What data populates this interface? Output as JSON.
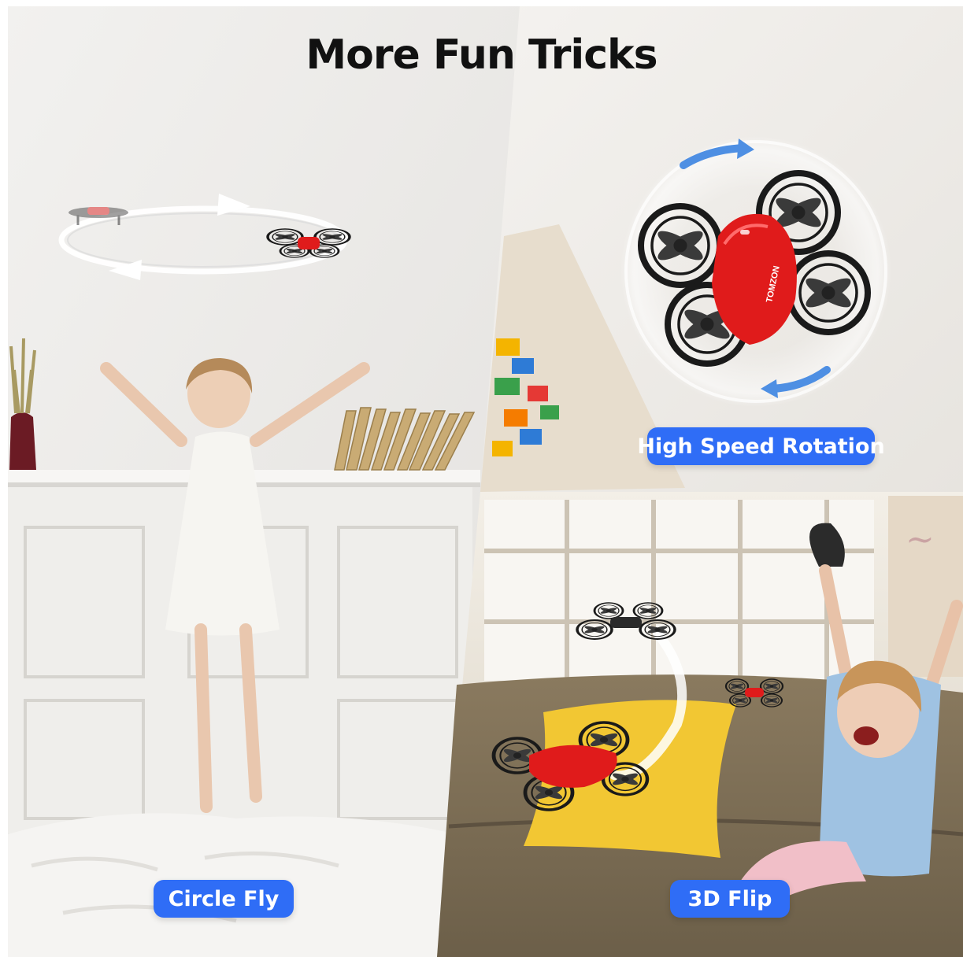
{
  "heading": "More Fun Tricks",
  "features": {
    "circle_fly": "Circle Fly",
    "high_speed_rotation": "High Speed Rotation",
    "flip_3d": "3D Flip"
  },
  "brand_marking": "TOMZON",
  "colors": {
    "accent": "#2f6df6",
    "drone_red": "#e01b1b",
    "heading": "#111111"
  }
}
